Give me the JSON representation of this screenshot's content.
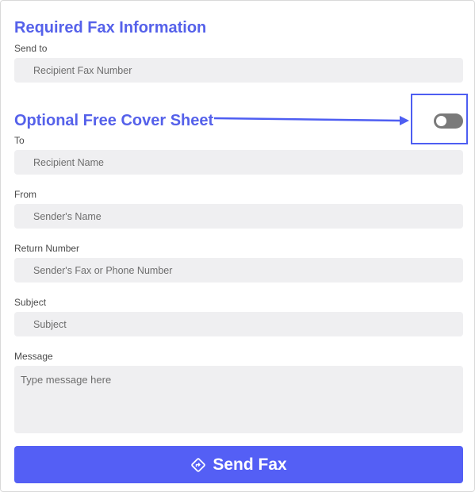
{
  "required": {
    "title": "Required Fax Information",
    "send_to_label": "Send to",
    "send_to_placeholder": "Recipient Fax Number"
  },
  "cover_sheet": {
    "title": "Optional Free Cover Sheet",
    "toggle_on": false,
    "to_label": "To",
    "to_placeholder": "Recipient Name",
    "from_label": "From",
    "from_placeholder": "Sender's Name",
    "return_label": "Return Number",
    "return_placeholder": "Sender's Fax or Phone Number",
    "subject_label": "Subject",
    "subject_placeholder": "Subject",
    "message_label": "Message",
    "message_placeholder": "Type message here"
  },
  "action": {
    "send_label": "Send Fax",
    "icon": "send-direction-icon"
  },
  "colors": {
    "accent": "#545ff5",
    "title": "#5561ea",
    "field_bg": "#efeff1",
    "toggle_off": "#7a7a7a"
  }
}
